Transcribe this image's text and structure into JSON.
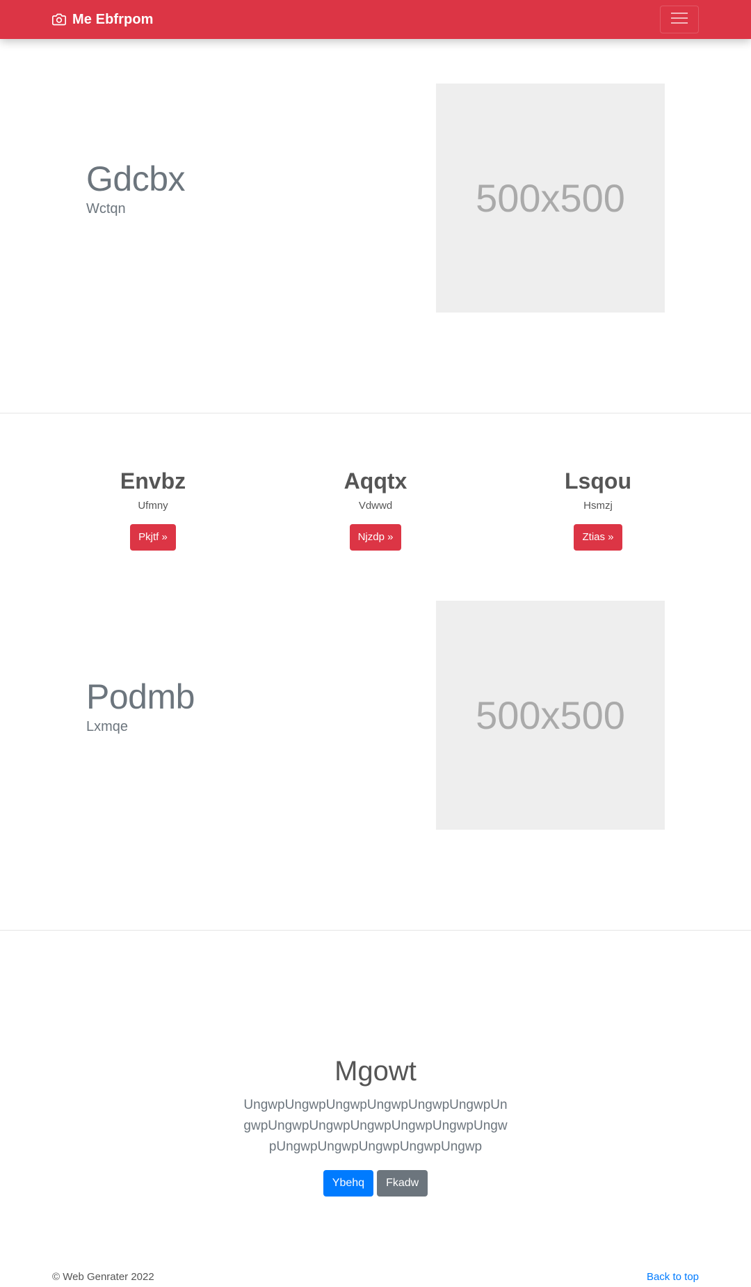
{
  "navbar": {
    "brand": "Me Ebfrpom",
    "brand_icon": "camera-icon",
    "toggler_icon": "menu-icon",
    "brand_color": "#dc3545"
  },
  "feature1": {
    "heading": "Gdcbx",
    "subheading": "Wctqn",
    "image_label": "500x500"
  },
  "columns": [
    {
      "title": "Envbz",
      "text": "Ufmny",
      "button": "Pkjtf »"
    },
    {
      "title": "Aqqtx",
      "text": "Vdwwd",
      "button": "Njzdp »"
    },
    {
      "title": "Lsqou",
      "text": "Hsmzj",
      "button": "Ztias »"
    }
  ],
  "feature2": {
    "heading": "Podmb",
    "subheading": "Lxmqe",
    "image_label": "500x500"
  },
  "jumbotron": {
    "title": "Mgowt",
    "lead": "UngwpUngwpUngwpUngwpUngwpUngwpUngwpUngwpUngwpUngwpUngwpUngwpUngwpUngwpUngwpUngwpUngwpUngwp",
    "primary_button": "Ybehq",
    "secondary_button": "Fkadw"
  },
  "footer": {
    "copyright": "© Web Genrater 2022",
    "back_to_top": "Back to top"
  },
  "colors": {
    "primary": "#007bff",
    "secondary": "#6c757d",
    "danger": "#dc3545"
  }
}
